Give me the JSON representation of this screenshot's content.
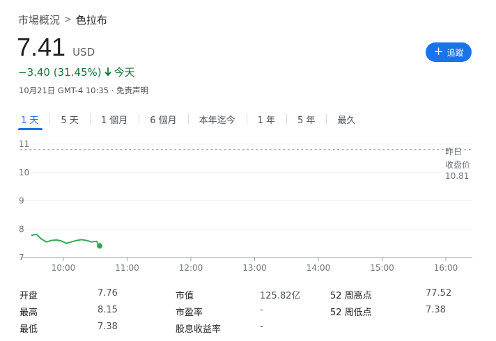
{
  "breadcrumb": {
    "root": "市場概況",
    "separator": ">",
    "current": "色拉布"
  },
  "quote": {
    "price": "7.41",
    "currency": "USD",
    "change": "−3.40 (31.45%)",
    "change_period": "今天",
    "timestamp": "10月21日 GMT-4 10:35 · 免责声明"
  },
  "follow_button": {
    "label": "追蹤",
    "color": "#1a73e8"
  },
  "tabs": [
    {
      "label": "1 天",
      "active": true
    },
    {
      "label": "5 天",
      "active": false
    },
    {
      "label": "1 個月",
      "active": false
    },
    {
      "label": "6 個月",
      "active": false
    },
    {
      "label": "本年迄今",
      "active": false
    },
    {
      "label": "1 年",
      "active": false
    },
    {
      "label": "5 年",
      "active": false
    },
    {
      "label": "最久",
      "active": false
    }
  ],
  "chart_data": {
    "type": "line",
    "x_ticks": [
      "10:00",
      "11:00",
      "12:00",
      "13:00",
      "14:00",
      "15:00",
      "16:00"
    ],
    "y_ticks": [
      11,
      10,
      9,
      8,
      7
    ],
    "ylim": [
      7,
      11
    ],
    "x_range_minutes": [
      570,
      960
    ],
    "series": [
      {
        "color": "#34a853",
        "points": [
          [
            570,
            7.78
          ],
          [
            575,
            7.82
          ],
          [
            580,
            7.65
          ],
          [
            585,
            7.55
          ],
          [
            590,
            7.6
          ],
          [
            595,
            7.62
          ],
          [
            600,
            7.58
          ],
          [
            605,
            7.5
          ],
          [
            610,
            7.55
          ],
          [
            615,
            7.6
          ],
          [
            620,
            7.63
          ],
          [
            625,
            7.6
          ],
          [
            630,
            7.55
          ],
          [
            635,
            7.57
          ],
          [
            638,
            7.41
          ]
        ]
      }
    ],
    "previous_close": {
      "label_line1": "昨日",
      "label_line2": "收盘价",
      "value": "10.81",
      "y": 10.81
    }
  },
  "stats": {
    "col1": [
      {
        "label": "开盘",
        "value": "7.76"
      },
      {
        "label": "最高",
        "value": "8.15"
      },
      {
        "label": "最低",
        "value": "7.38"
      }
    ],
    "col2": [
      {
        "label": "市值",
        "value": "125.82亿"
      },
      {
        "label": "市盈率",
        "value": "-"
      },
      {
        "label": "股息收益率",
        "value": "-"
      }
    ],
    "col3": [
      {
        "label": "52 周高点",
        "value": "77.52"
      },
      {
        "label": "52 周低点",
        "value": "7.38"
      }
    ]
  },
  "colors": {
    "positive": "#137333",
    "accent": "#1a73e8",
    "line": "#34a853"
  }
}
